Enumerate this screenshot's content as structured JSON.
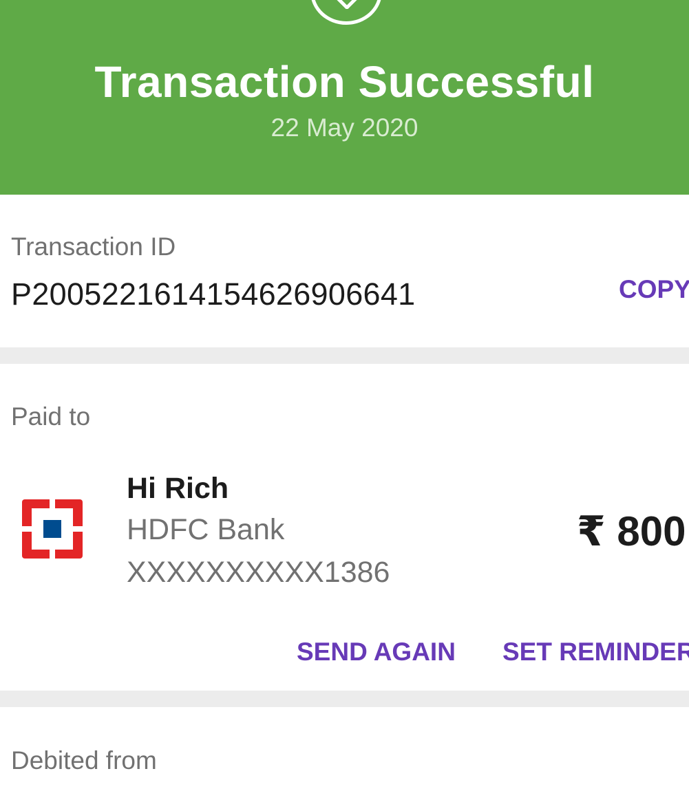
{
  "header": {
    "title": "Transaction Successful",
    "date": "22 May 2020",
    "status_icon": "check-circle-icon",
    "background_color": "#5faa47"
  },
  "transaction": {
    "id_label": "Transaction ID",
    "id_value": "P2005221614154626906641",
    "copy_label": "COPY"
  },
  "paid_to": {
    "label": "Paid to",
    "name": "Hi Rich",
    "bank": "HDFC Bank",
    "account": "XXXXXXXXXX1386",
    "amount": "₹ 800",
    "bank_logo_icon": "hdfc-bank-logo-icon",
    "send_again_label": "SEND AGAIN",
    "set_reminder_label": "SET REMINDER"
  },
  "debited_from": {
    "label": "Debited from"
  },
  "colors": {
    "accent": "#673ab7",
    "success": "#5faa47",
    "logo_red": "#e32526",
    "logo_blue": "#004c8f"
  }
}
